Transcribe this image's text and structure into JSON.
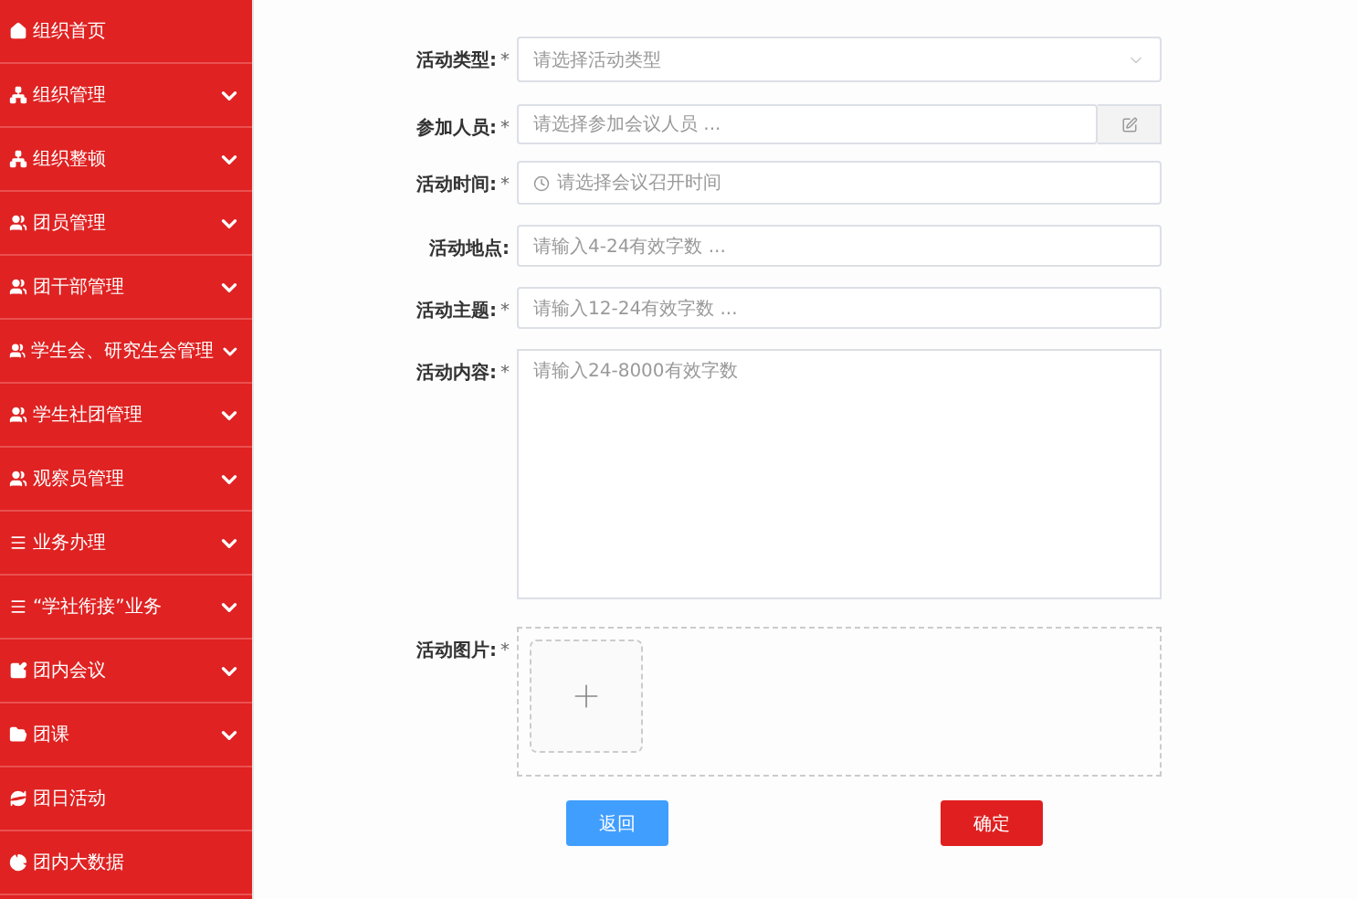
{
  "sidebar": {
    "items": [
      {
        "label": "组织首页",
        "kind": "home",
        "expandable": false
      },
      {
        "label": "组织管理",
        "kind": "sitemap",
        "expandable": true
      },
      {
        "label": "组织整顿",
        "kind": "sitemap",
        "expandable": true
      },
      {
        "label": "团员管理",
        "kind": "users",
        "expandable": true
      },
      {
        "label": "团干部管理",
        "kind": "users",
        "expandable": true
      },
      {
        "label": "学生会、研究生会管理",
        "kind": "users",
        "expandable": true
      },
      {
        "label": "学生社团管理",
        "kind": "users",
        "expandable": true
      },
      {
        "label": "观察员管理",
        "kind": "users",
        "expandable": true
      },
      {
        "label": "业务办理",
        "kind": "list",
        "expandable": true
      },
      {
        "label": "“学社衔接”业务",
        "kind": "list",
        "expandable": true
      },
      {
        "label": "团内会议",
        "kind": "edit",
        "expandable": true
      },
      {
        "label": "团课",
        "kind": "folder",
        "expandable": true
      },
      {
        "label": "团日活动",
        "kind": "refresh",
        "expandable": false
      },
      {
        "label": "团内大数据",
        "kind": "pie",
        "expandable": false
      }
    ]
  },
  "form": {
    "fields": [
      {
        "label": "活动类型:",
        "required_mark": "*",
        "kind": "select",
        "placeholder": "请选择活动类型"
      },
      {
        "label": "参加人员:",
        "required_mark": "*",
        "kind": "picker",
        "placeholder": "请选择参加会议人员 ..."
      },
      {
        "label": "活动时间:",
        "required_mark": "*",
        "kind": "time",
        "placeholder": "请选择会议召开时间"
      },
      {
        "label": "活动地点:",
        "kind": "text",
        "placeholder": "请输入4-24有效字数 ..."
      },
      {
        "label": "活动主题:",
        "required_mark": "*",
        "kind": "text",
        "placeholder": "请输入12-24有效字数 ..."
      },
      {
        "label": "活动内容:",
        "required_mark": "*",
        "kind": "textarea",
        "placeholder": "请输入24-8000有效字数"
      },
      {
        "label": "活动图片:",
        "required_mark": "*",
        "kind": "upload"
      }
    ],
    "buttons": [
      {
        "label": "返回",
        "kind": "back"
      },
      {
        "label": "确定",
        "kind": "confirm"
      }
    ]
  }
}
